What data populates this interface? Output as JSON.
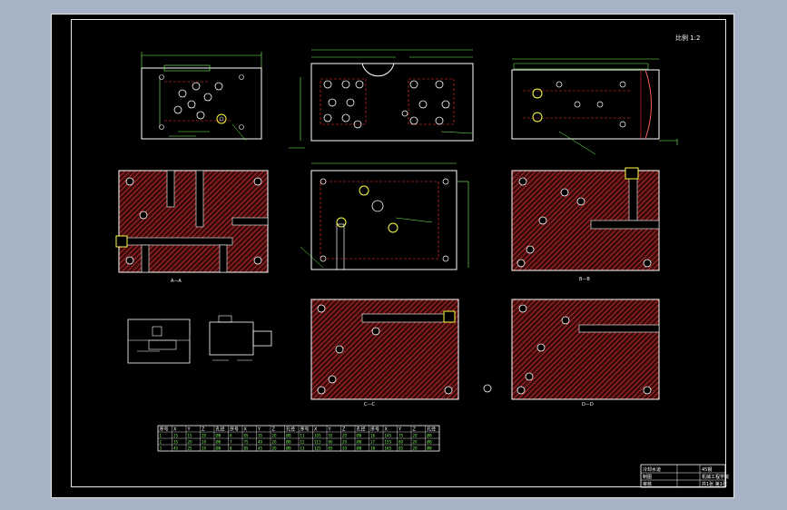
{
  "drawing": {
    "scale_note": "比例 1:2",
    "section_labels": {
      "a": "A—A",
      "b": "B—B",
      "c": "C—C",
      "d": "D—D"
    }
  },
  "title_block": {
    "title": "冷却水道",
    "material": "45钢",
    "drawn": "制图",
    "checked": "审核",
    "school": "机械工程学院",
    "sheet": "共1张 第1张"
  },
  "table": {
    "header": [
      "序号",
      "X",
      "Y",
      "Z",
      "孔径",
      "序号",
      "X",
      "Y",
      "Z",
      "孔径",
      "序号",
      "X",
      "Y",
      "Z",
      "孔径",
      "序号",
      "X",
      "Y",
      "Z",
      "孔径"
    ],
    "rows": [
      [
        "1",
        "25",
        "15",
        "20",
        "Ø8",
        "6",
        "65",
        "35",
        "20",
        "Ø8",
        "11",
        "105",
        "55",
        "20",
        "Ø8",
        "16",
        "145",
        "75",
        "20",
        "Ø8"
      ],
      [
        "2",
        "35",
        "20",
        "20",
        "Ø8",
        "7",
        "75",
        "40",
        "20",
        "Ø8",
        "12",
        "115",
        "60",
        "20",
        "Ø8",
        "17",
        "155",
        "80",
        "20",
        "Ø8"
      ],
      [
        "3",
        "45",
        "25",
        "20",
        "Ø8",
        "8",
        "85",
        "45",
        "20",
        "Ø8",
        "13",
        "125",
        "65",
        "20",
        "Ø8",
        "18",
        "165",
        "85",
        "20",
        "Ø8"
      ]
    ]
  },
  "colors": {
    "background": "#000000",
    "outline": "#ffffff",
    "dimension": "#7dff5a",
    "centerline": "#ff3030",
    "hatch": "#8b1a1a",
    "highlight": "#ffff40"
  }
}
